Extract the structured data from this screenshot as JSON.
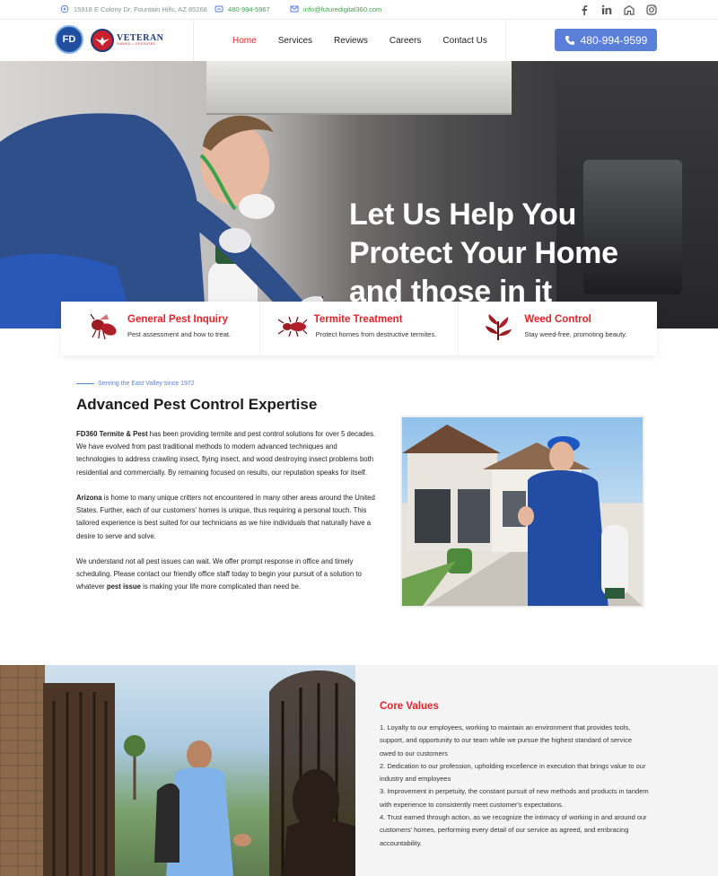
{
  "topbar": {
    "address": "15918 E Colony Dr, Fountain Hills, AZ 85268",
    "phone": "480-994-5967",
    "email": "info@futuredigital360.com",
    "socials": [
      "facebook-icon",
      "linkedin-icon",
      "nextdoor-icon",
      "instagram-icon"
    ]
  },
  "header": {
    "logo_fd_text": "FD",
    "logo_vet_text": "VETERAN",
    "logo_vet_sub": "OWNED • OPERATED",
    "nav": [
      {
        "label": "Home",
        "active": true
      },
      {
        "label": "Services",
        "active": false
      },
      {
        "label": "Reviews",
        "active": false
      },
      {
        "label": "Careers",
        "active": false
      },
      {
        "label": "Contact Us",
        "active": false
      }
    ],
    "call_label": "480-994-9599"
  },
  "hero": {
    "title_lines": [
      "Let Us Help You",
      "Protect Your Home",
      "and those in it"
    ]
  },
  "cards": [
    {
      "title": "General Pest Inquiry",
      "desc": "Pest assessment and how to treat.",
      "icon": "wasp-icon"
    },
    {
      "title": "Termite Treatment",
      "desc": "Protect homes from destructive termites.",
      "icon": "termite-icon"
    },
    {
      "title": "Weed Control",
      "desc": "Stay weed-free, promoting beauty.",
      "icon": "weed-icon"
    }
  ],
  "about": {
    "eyebrow": "Serving the East Valley since 1972",
    "title": "Advanced Pest Control Expertise",
    "p1_bold": "FD360 Termite & Pest",
    "p1_rest": " has been providing termite and pest control solutions for over 5 decades. We have evolved from past traditional methods to modern advanced techniques and technologies to address crawling insect, flying insect, and wood destroying insect problems both residential and commercially. By remaining focused on results, our reputation speaks for itself.",
    "p2_bold": "Arizona",
    "p2_rest": " is home to many unique critters not encountered in many other areas around the United States. Further, each of our customers' homes is unique, thus requiring a personal touch. This tailored experience is best suited for our technicians as we hire individuals that naturally have a desire to serve and solve.",
    "p3_start": "We understand not all pest issues can wait. We offer prompt response in office and timely scheduling. Please contact our friendly office staff today to begin your pursuit of a solution to whatever ",
    "p3_bold": "pest issue",
    "p3_end": " is making your life more complicated than need be."
  },
  "core": {
    "title": "Core Values",
    "items": [
      "1. Loyalty to our employees, working to maintain an environment that provides tools, support, and opportunity to our team while we pursue the highest standard of service owed to our customers",
      "2. Dedication to our profession, upholding excellence in execution that brings value to our industry and employees",
      "3. Improvement in perpetuity, the constant pursuit of new methods and products in tandem with experience to consistently meet customer's expectations.",
      "4. Trust earned through action, as we recognize the intimacy of working in and around our customers' homes, performing every detail of our service as agreed, and embracing accountability."
    ]
  },
  "colors": {
    "accent_red": "#e2232a",
    "accent_blue": "#5a7fd8",
    "link_green": "#3aa34a"
  }
}
